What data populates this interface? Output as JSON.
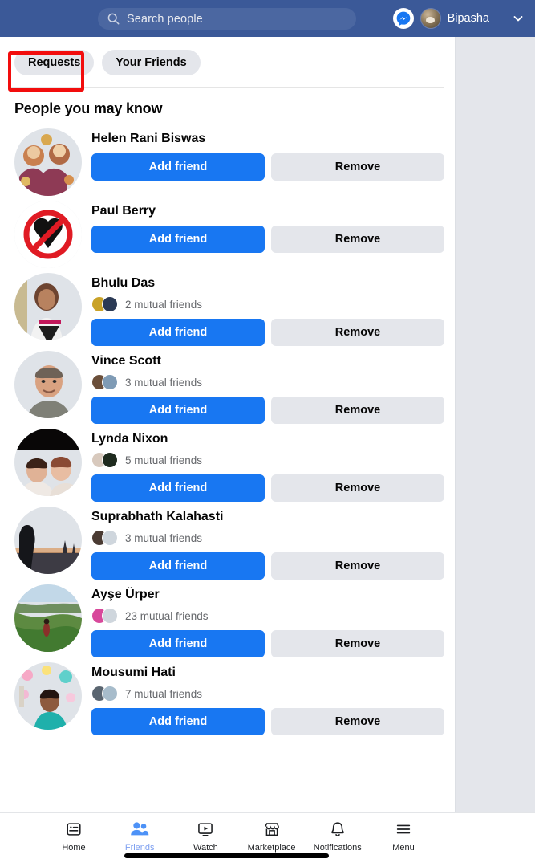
{
  "header": {
    "search": {
      "placeholder": "Search people",
      "value": "",
      "icon": "search-icon"
    },
    "messenger_icon": "messenger-icon",
    "profile_name": "Bipasha",
    "avatar_icon": "profile-avatar",
    "chevron_icon": "chevron-down-icon",
    "bg_color": "#3b5998"
  },
  "tabs": [
    {
      "label": "Requests",
      "active": true,
      "highlighted": true
    },
    {
      "label": "Your Friends",
      "active": false,
      "highlighted": false
    }
  ],
  "section": {
    "title": "People you may know"
  },
  "actions": {
    "add_label": "Add friend",
    "remove_label": "Remove"
  },
  "colors": {
    "primary_blue": "#1877f2",
    "header_blue": "#3b5998",
    "neutral_button": "#e4e6eb",
    "highlight_red": "#f20d0d",
    "muted_text": "#65676b"
  },
  "people": [
    {
      "name": "Helen Rani Biswas",
      "mutual_text": "",
      "mutual_count": 0,
      "avatar": "avatar-helen-rani-biswas"
    },
    {
      "name": "Paul Berry",
      "mutual_text": "",
      "mutual_count": 0,
      "avatar": "avatar-paul-berry-no-heart"
    },
    {
      "name": "Bhulu Das",
      "mutual_text": "2 mutual friends",
      "mutual_count": 2,
      "avatar": "avatar-bhulu-das"
    },
    {
      "name": "Vince Scott",
      "mutual_text": "3 mutual friends",
      "mutual_count": 3,
      "avatar": "avatar-vince-scott"
    },
    {
      "name": "Lynda Nixon",
      "mutual_text": "5 mutual friends",
      "mutual_count": 5,
      "avatar": "avatar-lynda-nixon"
    },
    {
      "name": "Suprabhath Kalahasti",
      "mutual_text": "3 mutual friends",
      "mutual_count": 3,
      "avatar": "avatar-suprabhath-kalahasti"
    },
    {
      "name": "Ayşe Ürper",
      "mutual_text": "23 mutual friends",
      "mutual_count": 23,
      "avatar": "avatar-ayse-urper"
    },
    {
      "name": "Mousumi Hati",
      "mutual_text": "7 mutual friends",
      "mutual_count": 7,
      "avatar": "avatar-mousumi-hati"
    }
  ],
  "bottom_nav": [
    {
      "label": "Home",
      "icon": "news-feed-icon",
      "active": false
    },
    {
      "label": "Friends",
      "icon": "friends-icon",
      "active": true
    },
    {
      "label": "Watch",
      "icon": "watch-video-icon",
      "active": false
    },
    {
      "label": "Marketplace",
      "icon": "marketplace-store-icon",
      "active": false
    },
    {
      "label": "Notifications",
      "icon": "bell-icon",
      "active": false
    },
    {
      "label": "Menu",
      "icon": "hamburger-menu-icon",
      "active": false
    }
  ]
}
